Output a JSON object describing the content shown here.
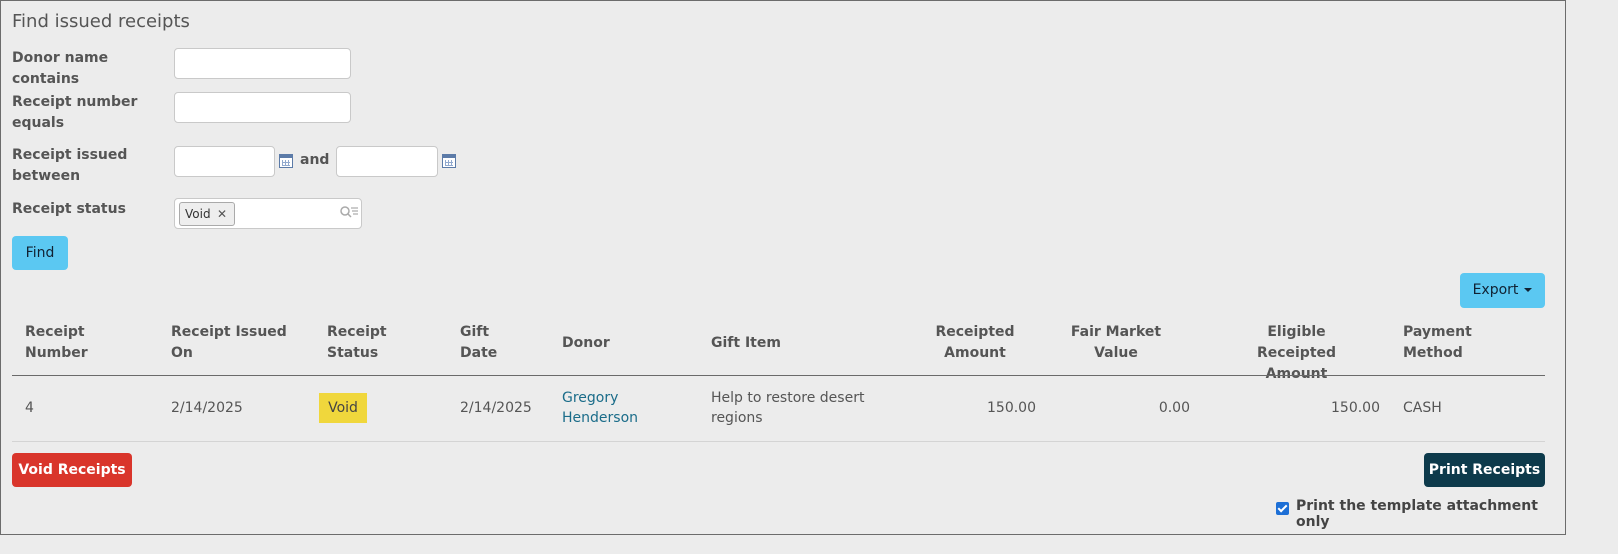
{
  "page": {
    "title": "Find issued receipts"
  },
  "form": {
    "donor_label": "Donor name contains",
    "donor_value": "",
    "receipt_number_label": "Receipt number equals",
    "receipt_number_value": "",
    "issued_between_label": "Receipt issued between",
    "issued_from": "",
    "issued_to": "",
    "and_label": "and",
    "status_label": "Receipt status",
    "status_tag": "Void",
    "find_label": "Find"
  },
  "toolbar": {
    "export_label": "Export"
  },
  "table": {
    "columns": [
      "Receipt Number",
      "Receipt Issued On",
      "Receipt Status",
      "Gift Date",
      "Donor",
      "Gift Item",
      "Receipted Amount",
      "Fair Market Value",
      "Eligible Receipted Amount",
      "Payment Method"
    ],
    "rows": [
      {
        "receipt_number": "4",
        "issued_on": "2/14/2025",
        "status": "Void",
        "gift_date": "2/14/2025",
        "donor": "Gregory Henderson",
        "gift_item": "Help to restore desert regions",
        "receipted_amount": "150.00",
        "fair_market_value": "0.00",
        "eligible_amount": "150.00",
        "payment_method": "CASH"
      }
    ]
  },
  "actions": {
    "void_label": "Void Receipts",
    "print_label": "Print Receipts",
    "template_only_label": "Print the template attachment only",
    "template_only_checked": true
  },
  "colors": {
    "primary_button": "#5bc8f2",
    "danger_button": "#d9352b",
    "dark_button": "#0d3a4b",
    "status_void_badge": "#f0d73c",
    "link": "#1a6c89"
  },
  "icons": {
    "calendar": "calendar-icon",
    "lookup": "search-list-icon",
    "remove_tag": "close-icon",
    "dropdown": "caret-down-icon"
  }
}
